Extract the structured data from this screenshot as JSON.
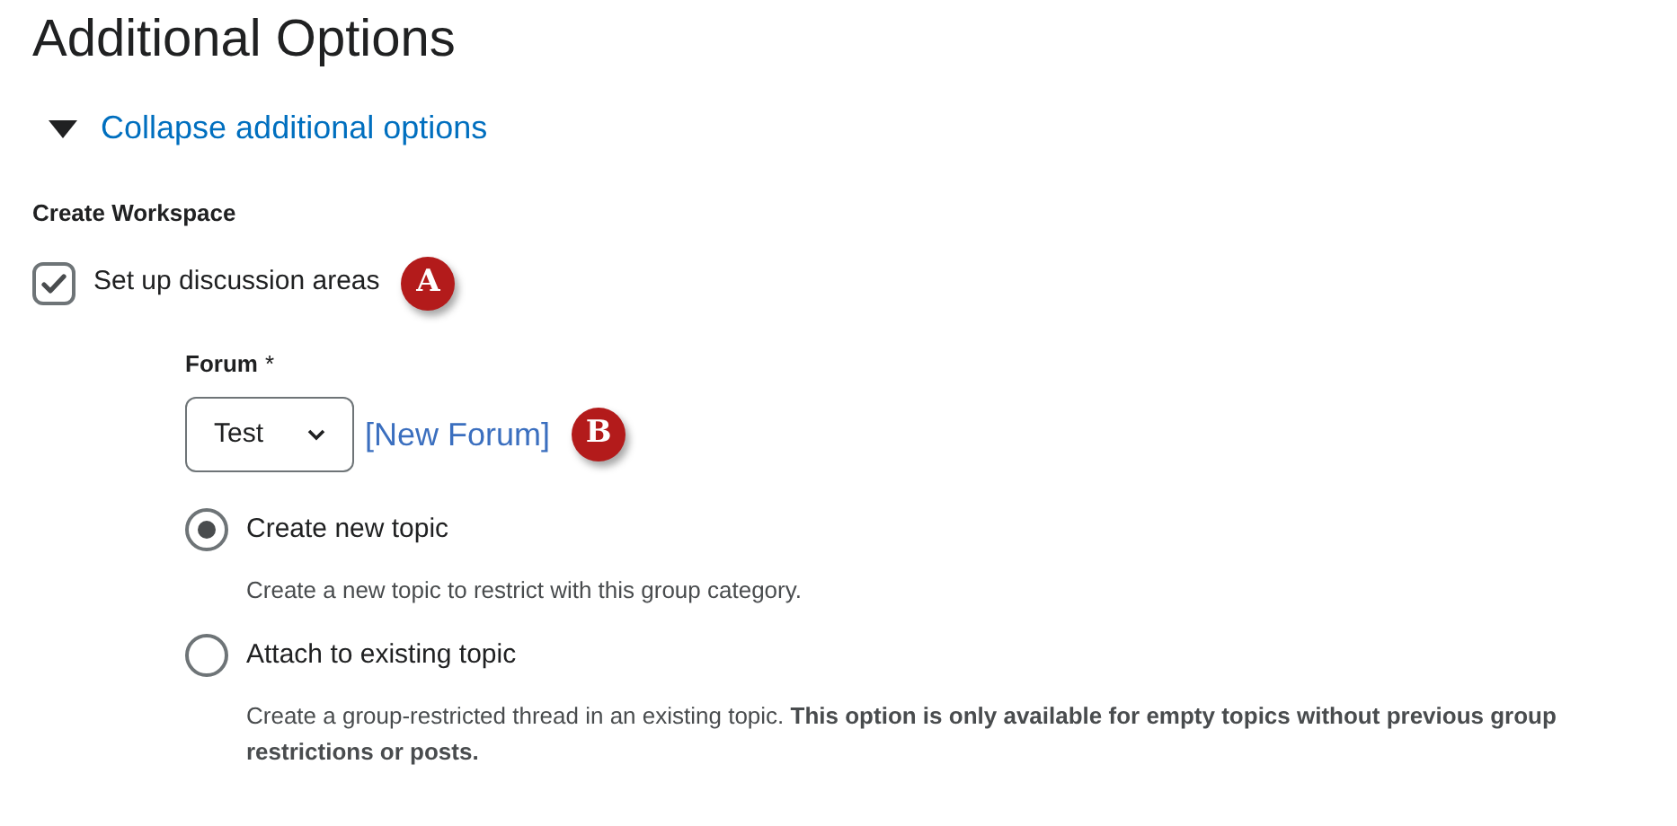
{
  "heading": "Additional Options",
  "collapse_link": {
    "label": "Collapse additional options",
    "expanded": true
  },
  "section_label": "Create Workspace",
  "discussion_checkbox": {
    "label": "Set up discussion areas",
    "checked": true,
    "callout": "A"
  },
  "forum": {
    "label": "Forum",
    "required_mark": "*",
    "value": "Test",
    "new_link": "[New Forum]",
    "callout": "B"
  },
  "topic_options": [
    {
      "label": "Create new topic",
      "selected": true,
      "description": "Create a new topic to restrict with this group category."
    },
    {
      "label": "Attach to existing topic",
      "selected": false,
      "description": "Create a group-restricted thread in an existing topic. **This option is only available for empty topics without previous group restrictions or posts.**"
    }
  ]
}
